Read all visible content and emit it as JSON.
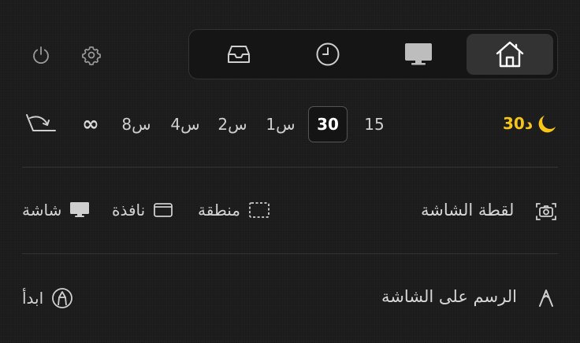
{
  "header": {
    "tabs": [
      {
        "name": "home",
        "icon": "home-icon",
        "active": true
      },
      {
        "name": "display",
        "icon": "monitor-icon",
        "active": false
      },
      {
        "name": "history",
        "icon": "clock-icon",
        "active": false
      },
      {
        "name": "inbox",
        "icon": "tray-icon",
        "active": false
      }
    ],
    "settings_icon": "gear-icon",
    "power_icon": "power-icon"
  },
  "keep_awake": {
    "icon": "moon-icon",
    "current_label": "30د",
    "durations": [
      "15",
      "30",
      "1س",
      "2س",
      "4س",
      "8س",
      "∞"
    ],
    "selected": "30",
    "exit_icon": "end-session-icon"
  },
  "screenshot": {
    "label": "لقطة الشاشة",
    "icon": "camera-icon",
    "options": [
      {
        "label": "منطقة",
        "icon": "dashed-rect-icon"
      },
      {
        "label": "نافذة",
        "icon": "window-icon"
      },
      {
        "label": "شاشة",
        "icon": "monitor-icon"
      }
    ]
  },
  "draw": {
    "label": "الرسم على الشاشة",
    "icon": "caret-icon",
    "start_label": "ابدأ",
    "start_icon": "pen-circle-icon"
  },
  "colors": {
    "accent": "#f5c518",
    "background": "#1b1b1b"
  }
}
